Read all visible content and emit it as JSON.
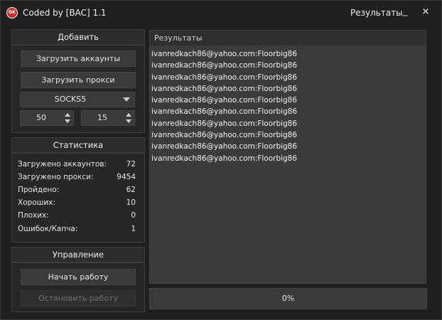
{
  "window": {
    "title": "Coded by [BAC] 1.1",
    "icon_text": "DK",
    "results_tab": "Результаты",
    "minimize": "_",
    "close": "×"
  },
  "add": {
    "header": "Добавить",
    "load_accounts": "Загрузить аккаунты",
    "load_proxies": "Загрузить прокси",
    "proxy_type": "SOCKS5",
    "threads": "50",
    "timeout": "15"
  },
  "stats": {
    "header": "Статистика",
    "rows": [
      {
        "label": "Загружено аккаунтов:",
        "value": "72"
      },
      {
        "label": "Загружено прокси:",
        "value": "9454"
      },
      {
        "label": "Пройдено:",
        "value": "62"
      },
      {
        "label": "Хороших:",
        "value": "10"
      },
      {
        "label": "Плохих:",
        "value": "0"
      },
      {
        "label": "Ошибок/Капча:",
        "value": "1"
      }
    ]
  },
  "control": {
    "header": "Управление",
    "start": "Начать работу",
    "stop": "Остановить работу"
  },
  "results": {
    "header": "Результаты",
    "lines": [
      "ivanredkach86@yahoo.com:Floorbig86",
      "ivanredkach86@yahoo.com:Floorbig86",
      "ivanredkach86@yahoo.com:Floorbig86",
      "ivanredkach86@yahoo.com:Floorbig86",
      "ivanredkach86@yahoo.com:Floorbig86",
      "ivanredkach86@yahoo.com:Floorbig86",
      "ivanredkach86@yahoo.com:Floorbig86",
      "ivanredkach86@yahoo.com:Floorbig86",
      "ivanredkach86@yahoo.com:Floorbig86",
      "ivanredkach86@yahoo.com:Floorbig86"
    ]
  },
  "progress": {
    "label": "0%",
    "value": 0
  }
}
